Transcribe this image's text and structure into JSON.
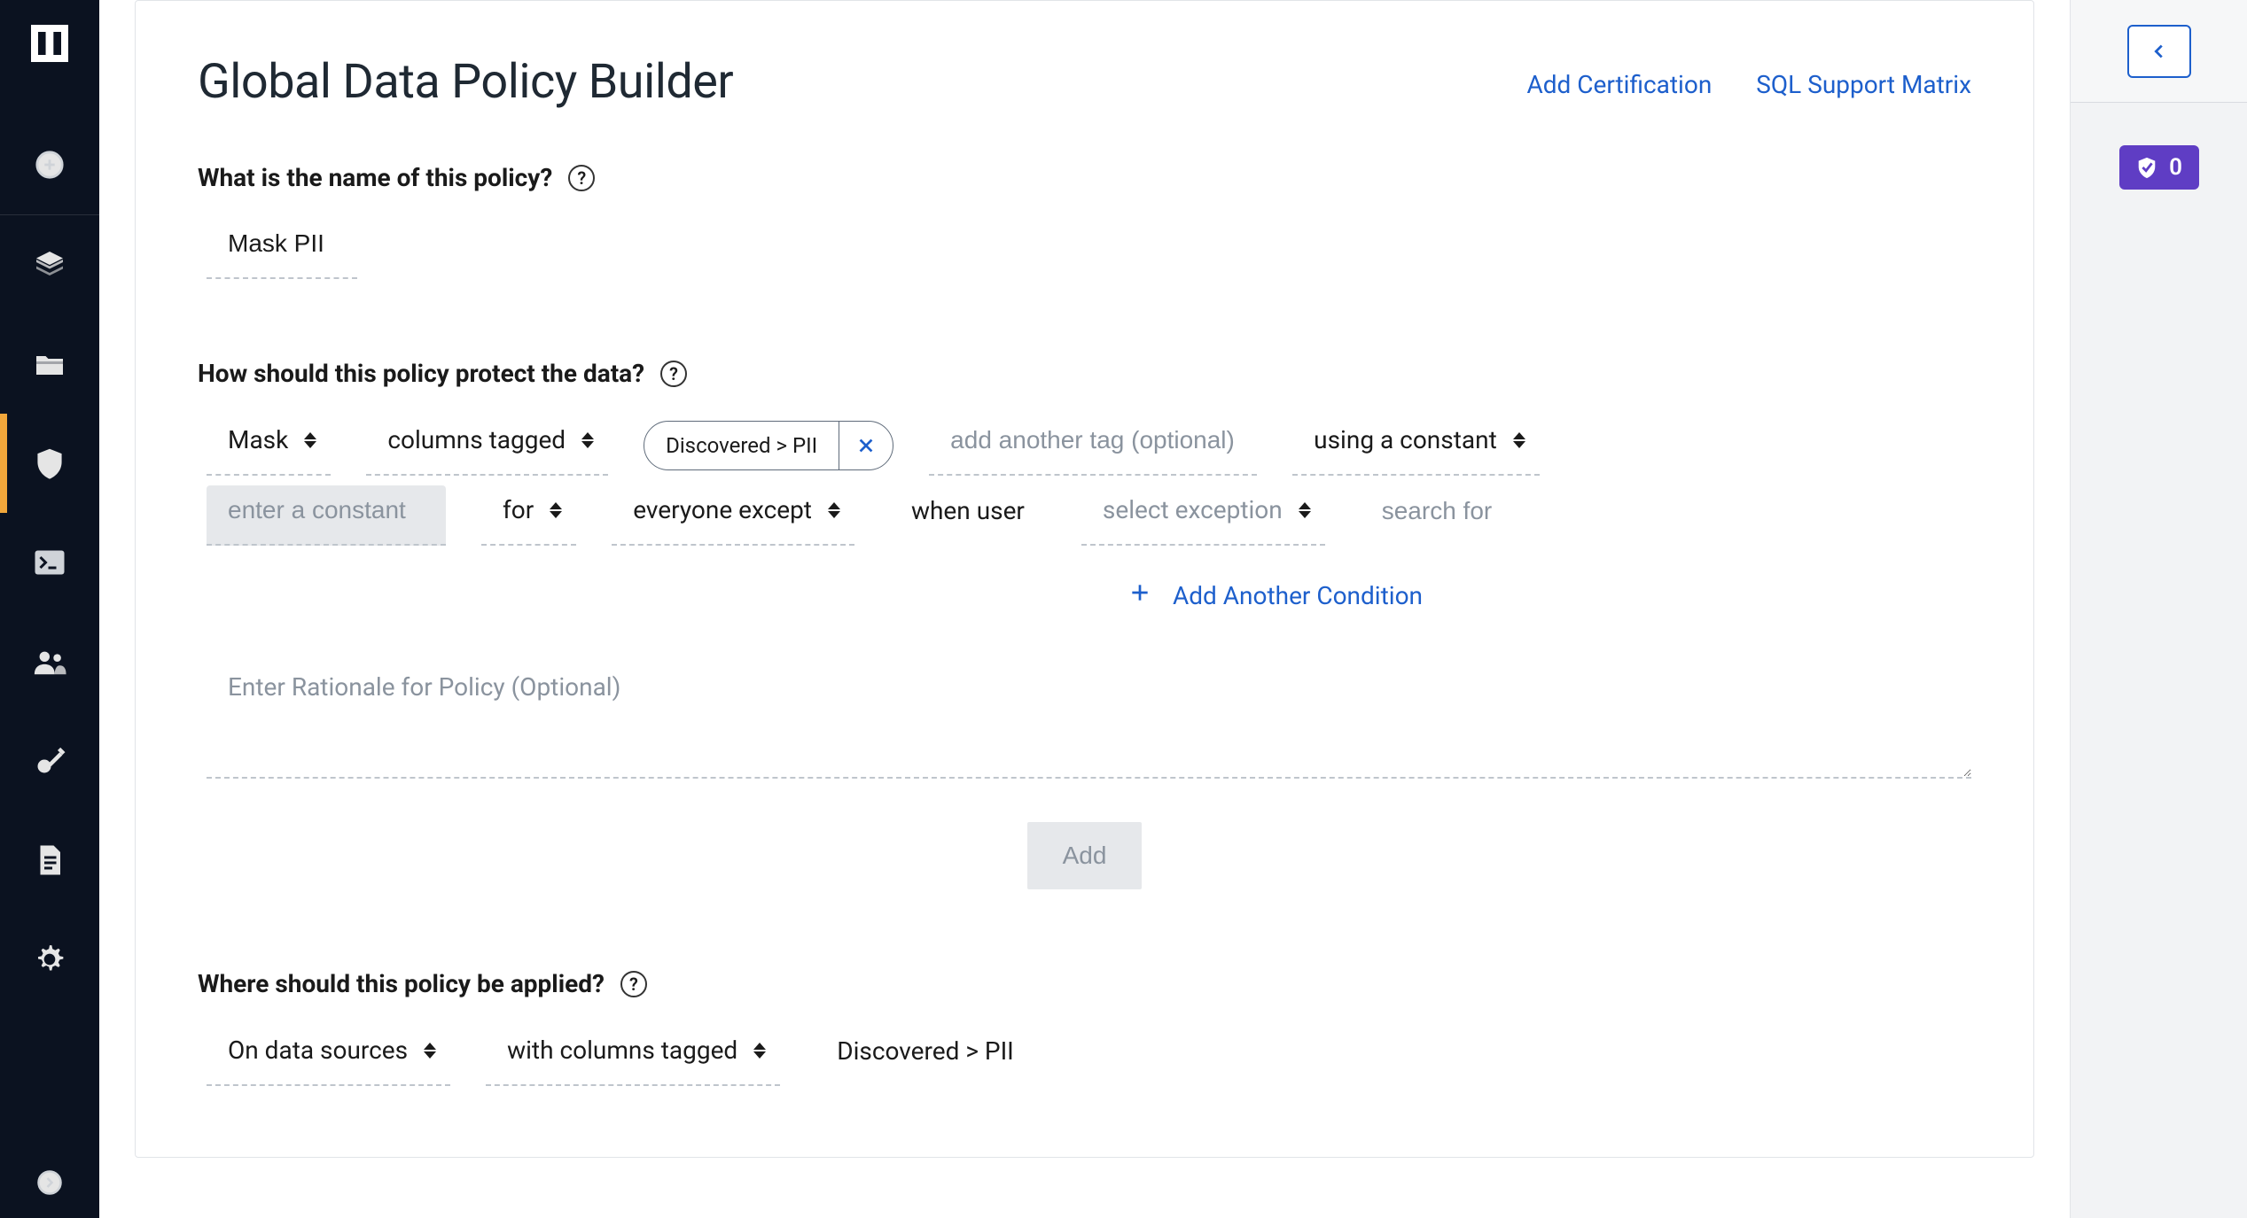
{
  "page": {
    "title": "Global Data Policy Builder",
    "link_add_cert": "Add Certification",
    "link_sql_matrix": "SQL Support Matrix"
  },
  "section_name": {
    "label": "What is the name of this policy?",
    "value": "Mask PII"
  },
  "section_protect": {
    "label": "How should this policy protect the data?",
    "action": "Mask",
    "target": "columns tagged",
    "tag_value": "Discovered > PII",
    "another_tag_placeholder": "add another tag (optional)",
    "using": "using a constant",
    "constant_placeholder": "enter a constant",
    "for_label": "for",
    "everyone_value": "everyone except",
    "when_user": "when user",
    "exception_placeholder": "select exception",
    "search_placeholder": "search for",
    "add_condition": "Add Another Condition",
    "rationale_placeholder": "Enter Rationale for Policy (Optional)",
    "add_btn": "Add"
  },
  "section_where": {
    "label": "Where should this policy be applied?",
    "on": "On data sources",
    "with": "with columns tagged",
    "tag_value": "Discovered > PII"
  },
  "right_rail": {
    "badge_count": "0"
  }
}
